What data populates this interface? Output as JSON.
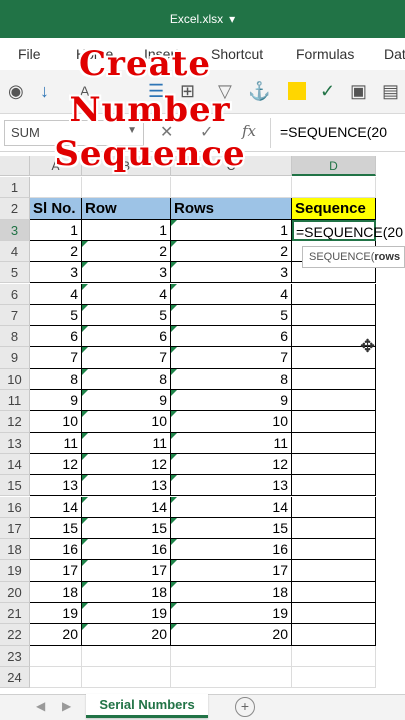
{
  "window": {
    "title": "Excel.xlsx",
    "title_caret": "▾"
  },
  "menu": [
    "File",
    "Home",
    "Insert",
    "Shortcut",
    "Formulas",
    "Data"
  ],
  "formula_bar": {
    "name_box": "SUM",
    "cancel": "✕",
    "enter": "✓",
    "fx": "fx",
    "content": "=SEQUENCE(20"
  },
  "overlay": {
    "line1": "Create",
    "line2": "Number",
    "line3": "Sequence"
  },
  "columns": [
    "A",
    "B",
    "C",
    "D"
  ],
  "row_numbers": [
    "1",
    "2",
    "3",
    "4",
    "5",
    "6",
    "7",
    "8",
    "9",
    "10",
    "11",
    "12",
    "13",
    "14",
    "15",
    "16",
    "17",
    "18",
    "19",
    "20",
    "21",
    "22",
    "23",
    "24"
  ],
  "headers": {
    "a": "Sl No.",
    "b": "Row",
    "c": "Rows",
    "d": "Sequence"
  },
  "values": [
    "1",
    "2",
    "3",
    "4",
    "5",
    "6",
    "7",
    "8",
    "9",
    "10",
    "11",
    "12",
    "13",
    "14",
    "15",
    "16",
    "17",
    "18",
    "19",
    "20"
  ],
  "active_cell_text": "=SEQUENCE(20",
  "tooltip": {
    "func": "SEQUENCE(",
    "arg": "rows"
  },
  "sheet_tab": "Serial Numbers",
  "add_sheet": "+",
  "colors": {
    "excel_green": "#217346",
    "header_blue": "#9dc3e6",
    "header_yellow": "#ffff00",
    "overlay_red": "#e00000"
  }
}
